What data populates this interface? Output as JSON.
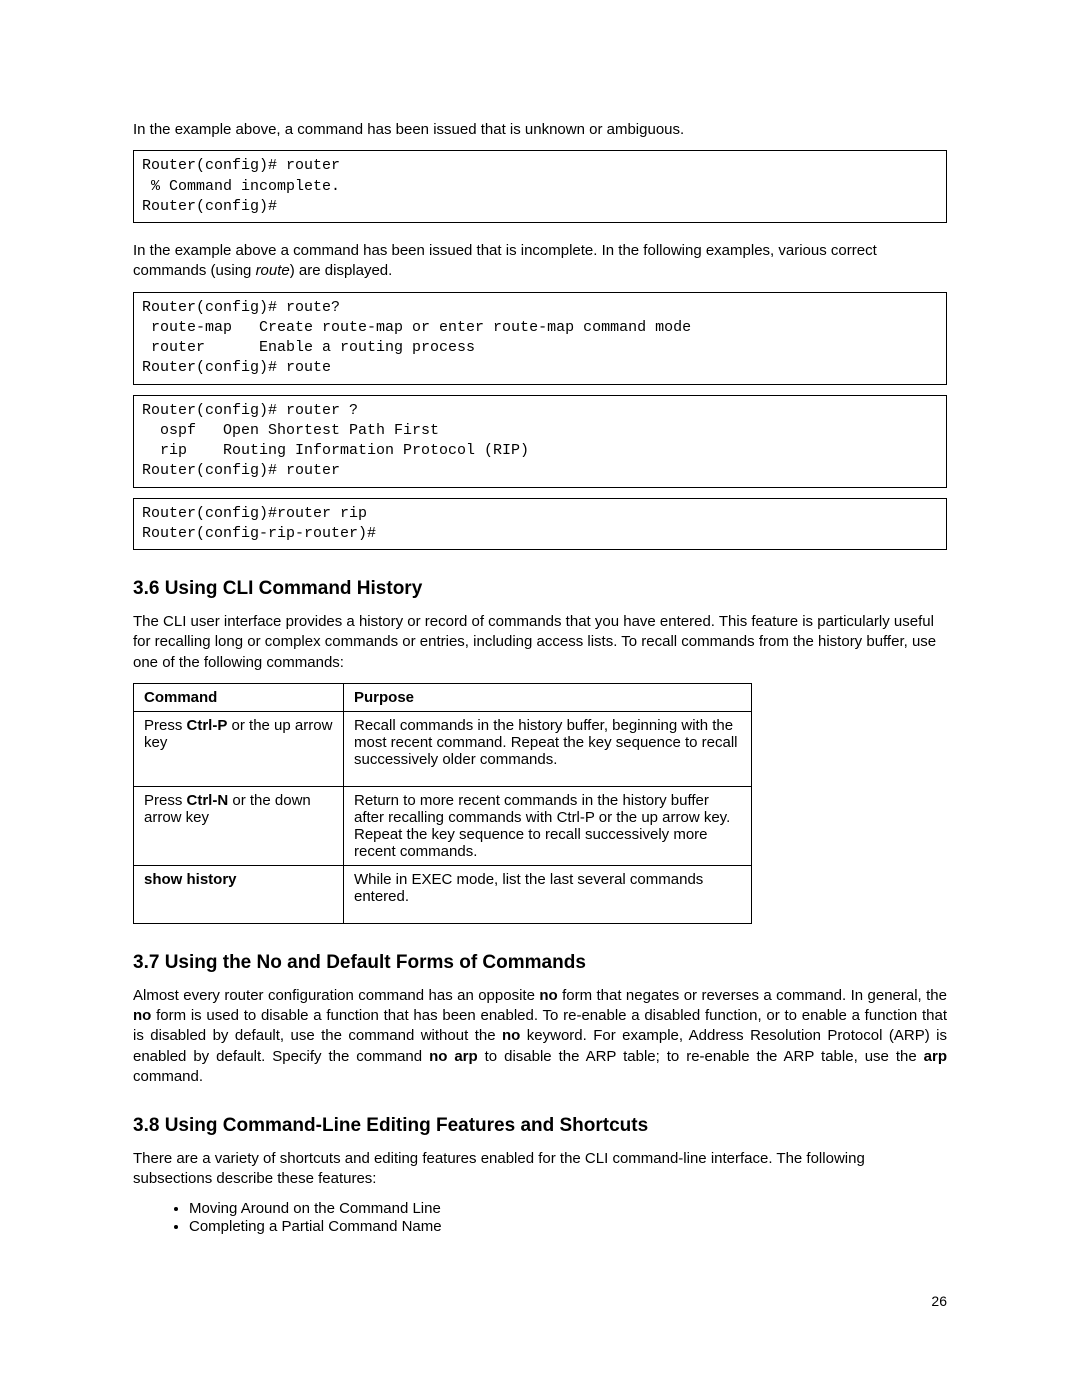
{
  "intro_para1": "In the example above, a command has been issued that is unknown or ambiguous.",
  "codebox1": "Router(config)# router\n % Command incomplete.\nRouter(config)#",
  "intro_para2_a": "In the example above a command has been issued that is incomplete. In the following examples, various correct commands (using ",
  "intro_para2_route": "route",
  "intro_para2_b": ") are displayed.",
  "codebox2": "Router(config)# route?\n route-map   Create route-map or enter route-map command mode\n router      Enable a routing process\nRouter(config)# route",
  "codebox3": "Router(config)# router ?\n  ospf   Open Shortest Path First\n  rip    Routing Information Protocol (RIP)\nRouter(config)# router",
  "codebox4": "Router(config)#router rip\nRouter(config-rip-router)#",
  "h36": "3.6 Using CLI Command History",
  "p36": "The CLI user interface provides a history or record of commands that you have entered. This feature is particularly useful for recalling long or complex commands or entries, including access lists. To recall commands from the history buffer, use one of the following commands:",
  "table": {
    "h1": "Command",
    "h2": "Purpose",
    "r1c1a": "Press ",
    "r1c1b": "Ctrl-P",
    "r1c1c": " or the up arrow key",
    "r1c2": "Recall commands in the history buffer, beginning with the most recent command. Repeat the key sequence to recall successively older commands.",
    "r2c1a": "Press ",
    "r2c1b": "Ctrl-N",
    "r2c1c": " or the down arrow key",
    "r2c2": "Return to more recent commands in the history buffer after recalling commands with Ctrl-P or the up arrow key. Repeat the key sequence to recall successively more recent commands.",
    "r3c1": "show history",
    "r3c2": "While in EXEC mode, list the last several commands entered."
  },
  "h37": "3.7 Using the No and Default Forms of Commands",
  "p37_1": "Almost every router configuration command has an opposite ",
  "p37_no1": "no",
  "p37_2": " form that negates or reverses a command. In general, the ",
  "p37_no2": "no",
  "p37_3": " form is used to disable a function that has been enabled. To re-enable a disabled function, or to enable a function that is disabled by default, use the command without the ",
  "p37_no3": "no",
  "p37_4": " keyword. For example, Address Resolution Protocol (ARP) is enabled by default. Specify the command ",
  "p37_noarp": "no arp",
  "p37_5": " to disable the ARP table; to re-enable the ARP table, use the ",
  "p37_arp": "arp",
  "p37_6": " command.",
  "h38": "3.8 Using Command-Line Editing Features and Shortcuts",
  "p38": "There are a variety of shortcuts and editing features enabled for the CLI command-line interface. The following subsections describe these features:",
  "li1": "Moving Around on the Command Line",
  "li2": "Completing a Partial Command Name",
  "pagenum": "26"
}
